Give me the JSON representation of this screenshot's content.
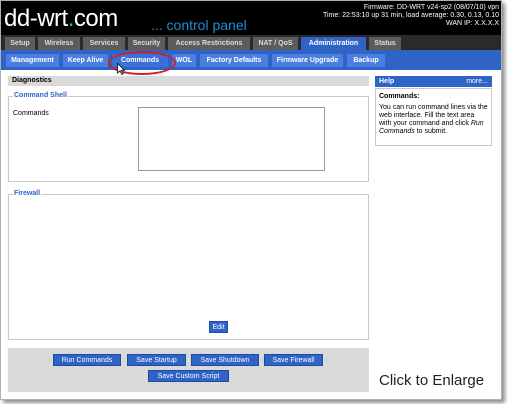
{
  "header": {
    "logo_main": "dd-wrt",
    "logo_dot": ".",
    "logo_com": "com",
    "logo_sub": "... control panel",
    "firmware": "Firmware: DD-WRT v24-sp2 (08/07/10) vpn",
    "time": "Time: 22:53:10 up 31 min, load average: 0.30, 0.13, 0.10",
    "wan_ip": "WAN IP: X.X.X.X"
  },
  "tabs": [
    {
      "label": "Setup"
    },
    {
      "label": "Wireless"
    },
    {
      "label": "Services"
    },
    {
      "label": "Security"
    },
    {
      "label": "Access Restrictions"
    },
    {
      "label": "NAT / QoS"
    },
    {
      "label": "Administration"
    },
    {
      "label": "Status"
    }
  ],
  "subtabs": [
    {
      "label": "Management"
    },
    {
      "label": "Keep Alive"
    },
    {
      "label": "Commands"
    },
    {
      "label": "WOL"
    },
    {
      "label": "Factory Defaults"
    },
    {
      "label": "Firmware Upgrade"
    },
    {
      "label": "Backup"
    }
  ],
  "main": {
    "section_title": "Diagnostics",
    "command_shell_legend": "Command Shell",
    "commands_label": "Commands",
    "firewall_legend": "Firewall",
    "edit_button": "Edit"
  },
  "buttons": {
    "run_commands": "Run Commands",
    "save_startup": "Save Startup",
    "save_shutdown": "Save Shutdown",
    "save_firewall": "Save Firewall",
    "save_custom_script": "Save Custom Script"
  },
  "help": {
    "title": "Help",
    "more": "more...",
    "heading": "Commands:",
    "text_a": "You can run command lines via the web interface. Fill the text area with your command and click ",
    "text_italic": "Run Commands",
    "text_b": " to submit."
  },
  "overlay": {
    "enlarge": "Click to Enlarge"
  },
  "colors": {
    "accent": "#2f63c5",
    "callout": "#cc2222"
  }
}
